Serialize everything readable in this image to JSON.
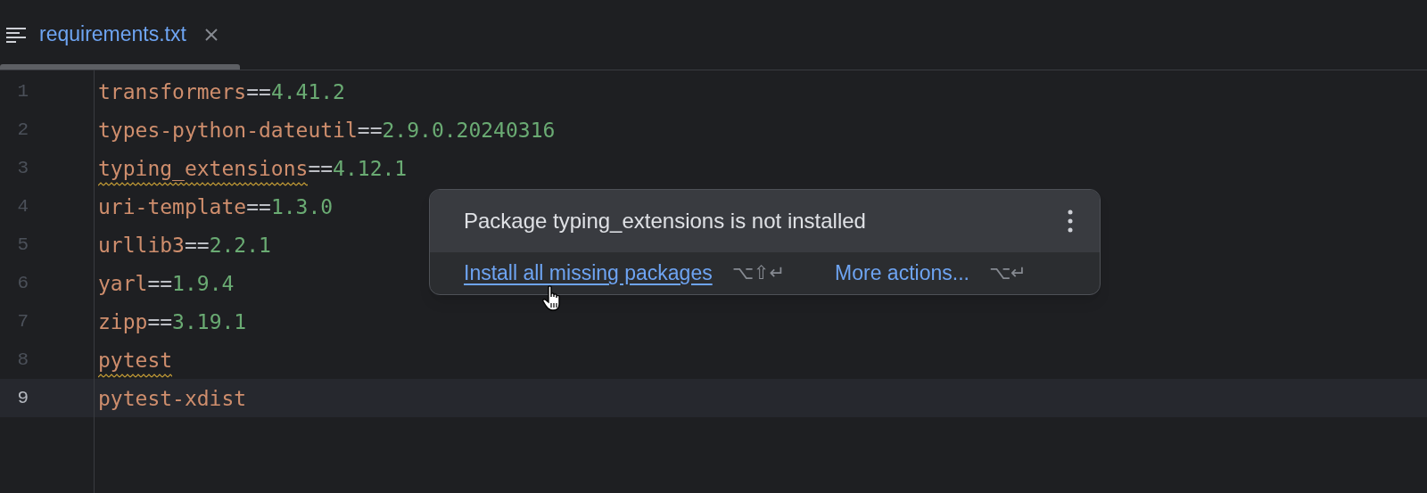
{
  "tab": {
    "label": "requirements.txt",
    "selected": true
  },
  "lines": [
    {
      "number": "1",
      "name": "transformers",
      "operator": "==",
      "version": "4.41.2",
      "warning": false,
      "current": false
    },
    {
      "number": "2",
      "name": "types-python-dateutil",
      "operator": "==",
      "version": "2.9.0.20240316",
      "warning": false,
      "current": false
    },
    {
      "number": "3",
      "name": "typing_extensions",
      "operator": "==",
      "version": "4.12.1",
      "warning": true,
      "current": false
    },
    {
      "number": "4",
      "name": "uri-template",
      "operator": "==",
      "version": "1.3.0",
      "warning": false,
      "current": false
    },
    {
      "number": "5",
      "name": "urllib3",
      "operator": "==",
      "version": "2.2.1",
      "warning": false,
      "current": false
    },
    {
      "number": "6",
      "name": "yarl",
      "operator": "==",
      "version": "1.9.4",
      "warning": false,
      "current": false
    },
    {
      "number": "7",
      "name": "zipp",
      "operator": "==",
      "version": "3.19.1",
      "warning": false,
      "current": false
    },
    {
      "number": "8",
      "name": "pytest",
      "warning": true,
      "current": false
    },
    {
      "number": "9",
      "name": "pytest-xdist",
      "warning": false,
      "current": true
    }
  ],
  "popup": {
    "message": "Package typing_extensions is not installed",
    "actions": [
      {
        "label": "Install all missing packages",
        "shortcut": "⌥⇧↵",
        "underlined": true
      },
      {
        "label": "More actions...",
        "shortcut": "⌥↵",
        "underlined": false
      }
    ]
  }
}
